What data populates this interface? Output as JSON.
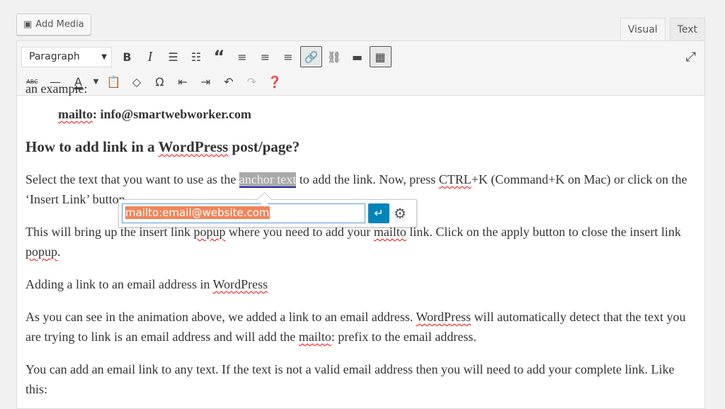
{
  "add_media": "Add Media",
  "tabs": {
    "visual": "Visual",
    "text": "Text"
  },
  "toolbar": {
    "format_select": "Paragraph"
  },
  "content": {
    "cut_line": "an example:",
    "mailto_example_prefix": "mailto",
    "mailto_example_rest": ": info@smartwebworker.com",
    "heading_pre": "How to add link in a ",
    "heading_wp": "WordPress",
    "heading_post": " post/page?",
    "p1_a": "Select the text that you want to use as the ",
    "p1_anchor": "anchor text",
    "p1_b": " to add the link. Now, press ",
    "p1_ctrl": "CTRL",
    "p1_c": "+K (Command+K on Mac) or click on the",
    "p1_d": "‘Insert Link’ button",
    "p2_a": "This will bring up the insert link ",
    "p2_popup": "popup",
    "p2_b": " where you need to add your ",
    "p2_mailto": "mailto",
    "p2_c": " link. Click on the apply button to close the insert link ",
    "p2_popup2": "popup",
    "p2_d": ".",
    "p3_a": "Adding a link to an email address in ",
    "p3_wp": "WordPress",
    "p4_a": "As you can see in the animation above, we added a link to an email address. ",
    "p4_wp": "WordPress",
    "p4_b": " will automatically detect that the text you are trying to link is an email address and will add the ",
    "p4_mailto": "mailto",
    "p4_c": ": prefix to the email address.",
    "p5": "You can add an email link to any text. If the text is not a valid email address then you will need to add your complete link. Like this:"
  },
  "link_popup": {
    "url": "mailto:email@website.com"
  }
}
